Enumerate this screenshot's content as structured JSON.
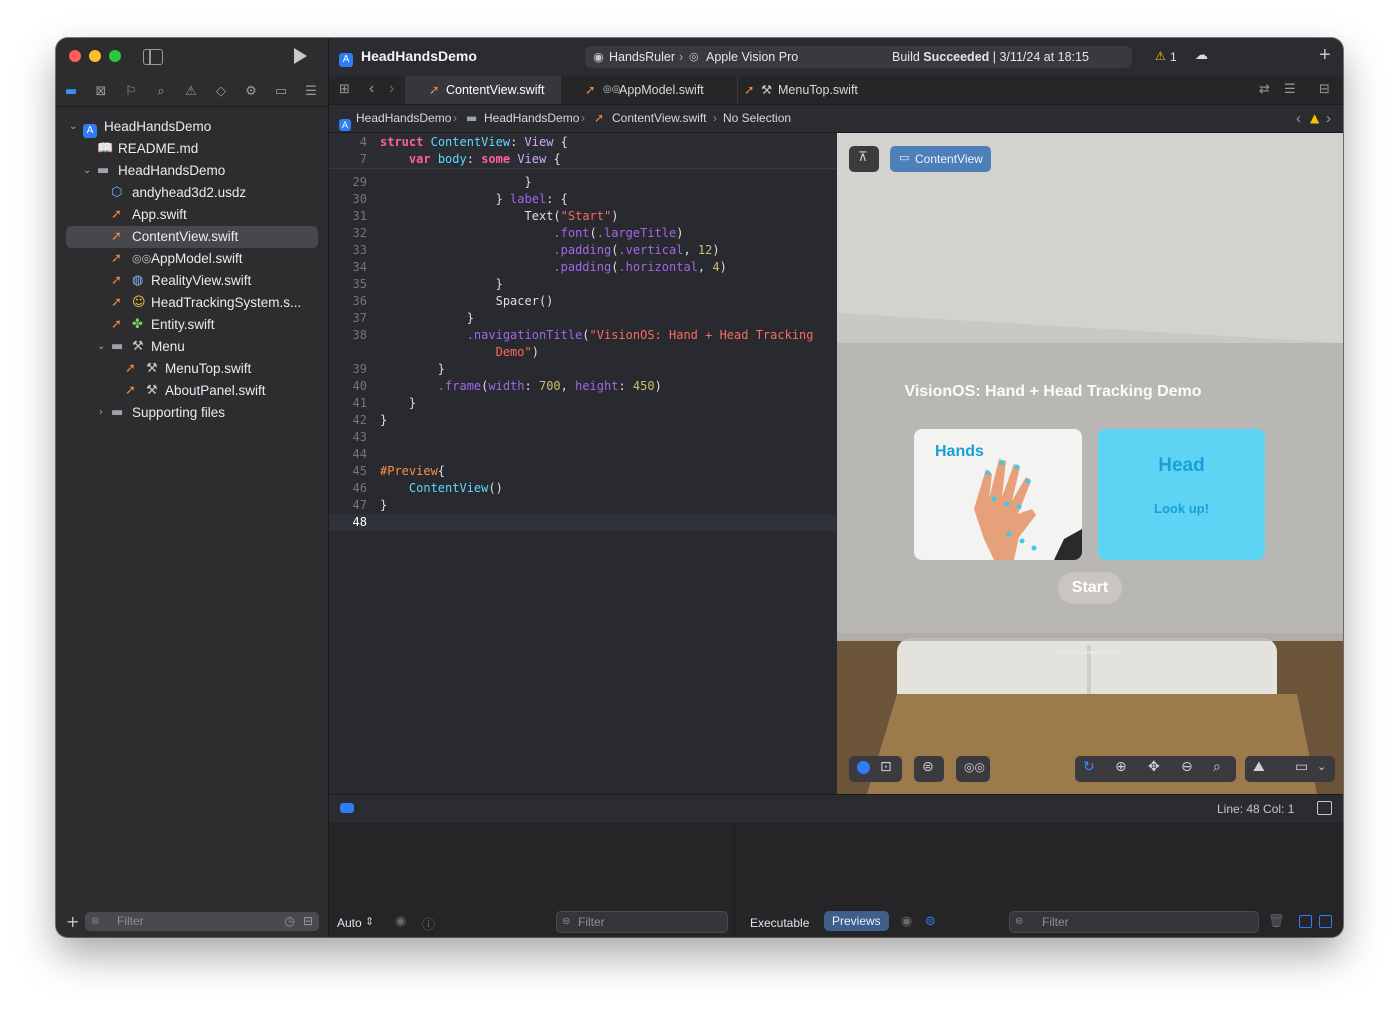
{
  "project": {
    "name": "HeadHandsDemo"
  },
  "toolbar": {
    "scheme_name": "HandsRuler",
    "destination": "Apple Vision Pro",
    "build_status_prefix": "Build",
    "build_status_result": "Succeeded",
    "build_status_time": "| 3/11/24 at 18:15",
    "warning_count": "1"
  },
  "sidebar": {
    "filter_placeholder": "Filter",
    "items": [
      {
        "label": "HeadHandsDemo"
      },
      {
        "label": "README.md"
      },
      {
        "label": "HeadHandsDemo"
      },
      {
        "label": "andyhead3d2.usdz"
      },
      {
        "label": "App.swift"
      },
      {
        "label": "ContentView.swift"
      },
      {
        "label": "AppModel.swift"
      },
      {
        "label": "RealityView.swift"
      },
      {
        "label": "HeadTrackingSystem.s..."
      },
      {
        "label": "Entity.swift"
      },
      {
        "label": "Menu"
      },
      {
        "label": "MenuTop.swift"
      },
      {
        "label": "AboutPanel.swift"
      },
      {
        "label": "Supporting files"
      }
    ]
  },
  "tabs": [
    {
      "label": "ContentView.swift"
    },
    {
      "label": "AppModel.swift"
    },
    {
      "label": "MenuTop.swift"
    }
  ],
  "breadcrumb": {
    "project": "HeadHandsDemo",
    "folder": "HeadHandsDemo",
    "file": "ContentView.swift",
    "selection": "No Selection"
  },
  "code": {
    "sticky": [
      {
        "n": "4"
      },
      {
        "n": "7"
      }
    ],
    "lines": [
      {
        "n": "29"
      },
      {
        "n": "30"
      },
      {
        "n": "31"
      },
      {
        "n": "32"
      },
      {
        "n": "33"
      },
      {
        "n": "34"
      },
      {
        "n": "35"
      },
      {
        "n": "36"
      },
      {
        "n": "37"
      },
      {
        "n": "38"
      },
      {
        "n": "39"
      },
      {
        "n": "40"
      },
      {
        "n": "41"
      },
      {
        "n": "42"
      },
      {
        "n": "43"
      },
      {
        "n": "44"
      },
      {
        "n": "45"
      },
      {
        "n": "46"
      },
      {
        "n": "47"
      },
      {
        "n": "48"
      }
    ],
    "tokens": {
      "struct": "struct",
      "ContentView": "ContentView",
      "colon_view": ": ",
      "View": "View",
      "brace": " {",
      "var": "var",
      "body": "body",
      "some": "some",
      "close29": "}",
      "label30_pre": "} ",
      "label30": "label",
      "label30_post": ": {",
      "text31": "Text",
      "paren_open": "(",
      "start_str": "\"Start\"",
      "paren_close": ")",
      "font32": ".font",
      "largeTitle": ".largeTitle",
      "padding33": ".padding",
      "vertical": ".vertical",
      "twelve": "12",
      "horizontal": ".horizontal",
      "four": "4",
      "close35": "}",
      "spacer36": "Spacer",
      "spacer_parens": "()",
      "close37": "}",
      "navTitle": ".navigationTitle",
      "nav_str1": "\"VisionOS: Hand + Head Tracking",
      "nav_str2": "Demo\"",
      "close39": "}",
      "frame40": ".frame",
      "width_lbl": "width",
      "seven_hundred": "700",
      "height_lbl": "height",
      "four_fifty": "450",
      "close41": "}",
      "close42": "}",
      "preview_macro": "#Preview",
      "content_call": "ContentView",
      "close47": "}"
    }
  },
  "preview": {
    "pin_icon": "pin-icon",
    "chip_label": "ContentView",
    "window_title": "VisionOS: Hand + Head Tracking Demo",
    "hands_title": "Hands",
    "head_title": "Head",
    "head_subtitle": "Look up!",
    "start_button": "Start",
    "colors": {
      "head_card": "#5ed4f4",
      "accent": "#1a9fd8"
    }
  },
  "debug_bar": {
    "position": "Line: 48  Col: 1"
  },
  "debug_area": {
    "auto_label": "Auto",
    "left_filter_placeholder": "Filter",
    "executable_tab": "Executable",
    "previews_tab": "Previews",
    "right_filter_placeholder": "Filter"
  }
}
